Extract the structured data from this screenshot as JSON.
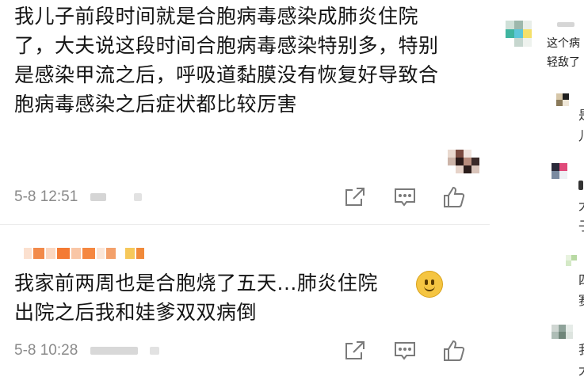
{
  "comments": [
    {
      "text": "我儿子前段时间就是合胞病毒感染成肺炎住院了，大夫说这段时间合胞病毒感染特别多，特别是感染甲流之后，呼吸道黏膜没有恢复好导致合胞病毒感染之后症状都比较厉害",
      "time": "5-8 12:51"
    },
    {
      "text": "我家前两周也是合胞烧了五天...肺炎住院",
      "text2": "出院之后我和娃爹双双病倒",
      "time": "5-8 10:28"
    }
  ],
  "icons": {
    "share": "share-icon",
    "comment": "comment-icon",
    "like": "thumbs-up-icon",
    "emoji": "smile-emoji-icon"
  },
  "side": {
    "line1": "这个病",
    "line2": "轻敌了",
    "frag1": "是",
    "frag2": "儿",
    "frag3": "大",
    "frag4": "子",
    "frag5": "四",
    "frag6": "赛",
    "frag7": "我",
    "frag8": "大"
  },
  "colors": {
    "text": "#141414",
    "meta": "#8a8a8a",
    "icon": "#7a7a7a",
    "divider": "#ececec"
  }
}
